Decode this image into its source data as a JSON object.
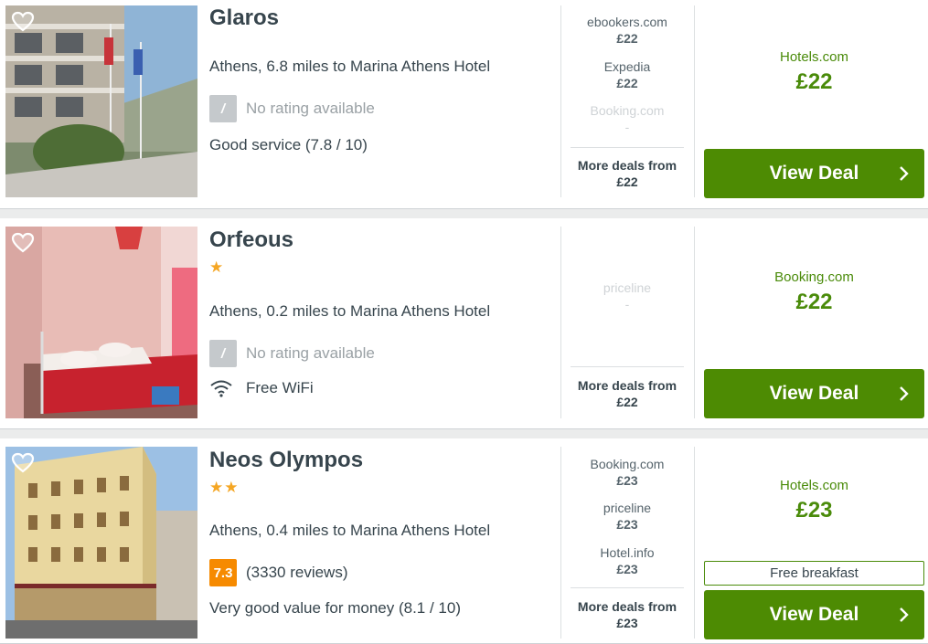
{
  "hotels": [
    {
      "name": "Glaros",
      "stars": "",
      "location": "Athens, 6.8 miles to Marina Athens Hotel",
      "rating_badge": "/",
      "rating_text": "No rating available",
      "extra": "Good service (7.8 / 10)",
      "deals": [
        {
          "site": "ebookers.com",
          "price": "£22"
        },
        {
          "site": "Expedia",
          "price": "£22"
        },
        {
          "site": "Booking.com",
          "price": "-"
        }
      ],
      "more_label": "More deals from",
      "more_price": "£22",
      "best_site": "Hotels.com",
      "best_price": "£22",
      "button": "View Deal"
    },
    {
      "name": "Orfeous",
      "stars": "★",
      "location": "Athens, 0.2 miles to Marina Athens Hotel",
      "rating_badge": "/",
      "rating_text": "No rating available",
      "extra": "Free WiFi",
      "deals": [
        {
          "site": "priceline",
          "price": "-"
        }
      ],
      "more_label": "More deals from",
      "more_price": "£22",
      "best_site": "Booking.com",
      "best_price": "£22",
      "button": "View Deal"
    },
    {
      "name": "Neos Olympos",
      "stars": "★★",
      "location": "Athens, 0.4 miles to Marina Athens Hotel",
      "rating_badge": "7.3",
      "rating_text": "(3330 reviews)",
      "extra": "Very good value for money (8.1 / 10)",
      "deals": [
        {
          "site": "Booking.com",
          "price": "£23"
        },
        {
          "site": "priceline",
          "price": "£23"
        },
        {
          "site": "Hotel.info",
          "price": "£23"
        }
      ],
      "more_label": "More deals from",
      "more_price": "£23",
      "best_site": "Hotels.com",
      "best_price": "£23",
      "perk": "Free breakfast",
      "button": "View Deal"
    }
  ],
  "icons": {
    "favorite": "heart-outline-icon",
    "wifi": "wifi-icon",
    "chevron": "chevron-right-icon"
  },
  "colors": {
    "accent_green": "#4d8b03",
    "price_green": "#4a8b0a",
    "rating_orange": "#f68a00",
    "star_gold": "#f5a623"
  }
}
